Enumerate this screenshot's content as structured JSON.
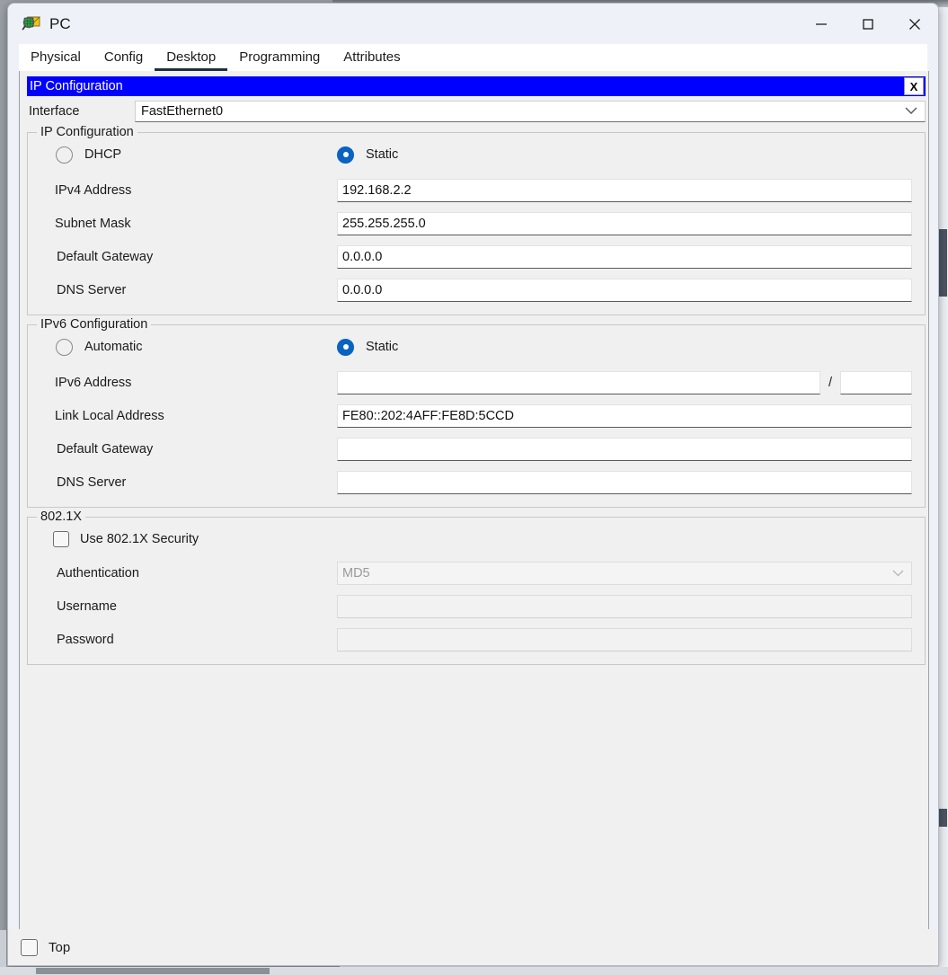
{
  "window": {
    "title": "PC",
    "icon": "packet-tracer-pc-icon",
    "controls": {
      "minimize": "—",
      "maximize": "□",
      "close": "✕"
    }
  },
  "tabs": [
    {
      "label": "Physical",
      "active": false
    },
    {
      "label": "Config",
      "active": false
    },
    {
      "label": "Desktop",
      "active": true
    },
    {
      "label": "Programming",
      "active": false
    },
    {
      "label": "Attributes",
      "active": false
    }
  ],
  "ip_configuration_panel": {
    "title": "IP Configuration",
    "close_label": "X",
    "interface": {
      "label": "Interface",
      "value": "FastEthernet0",
      "chevron": "⌄"
    },
    "ipv4": {
      "group_title": "IP Configuration",
      "mode_options": [
        {
          "label": "DHCP",
          "selected": false
        },
        {
          "label": "Static",
          "selected": true
        }
      ],
      "fields": [
        {
          "label": "IPv4 Address",
          "value": "192.168.2.2",
          "placeholder": ""
        },
        {
          "label": "Subnet Mask",
          "value": "255.255.255.0",
          "placeholder": ""
        },
        {
          "label": "Default Gateway",
          "value": "0.0.0.0",
          "placeholder": ""
        },
        {
          "label": "DNS Server",
          "value": "0.0.0.0",
          "placeholder": ""
        }
      ]
    },
    "ipv6": {
      "group_title": "IPv6 Configuration",
      "mode_options": [
        {
          "label": "Automatic",
          "selected": false
        },
        {
          "label": "Static",
          "selected": true
        }
      ],
      "address": {
        "label": "IPv6 Address",
        "value": "",
        "separator": "/",
        "prefix_value": ""
      },
      "fields": [
        {
          "label": "Link Local Address",
          "value": "FE80::202:4AFF:FE8D:5CCD"
        },
        {
          "label": "Default Gateway",
          "value": ""
        },
        {
          "label": "DNS Server",
          "value": ""
        }
      ]
    },
    "dot1x": {
      "group_title": "802.1X",
      "use_security": {
        "label": "Use 802.1X Security",
        "checked": false
      },
      "authentication": {
        "label": "Authentication",
        "value": "MD5",
        "chevron": "⌄",
        "disabled": true
      },
      "username": {
        "label": "Username",
        "value": "",
        "disabled": true
      },
      "password": {
        "label": "Password",
        "value": "",
        "disabled": true
      }
    }
  },
  "bottom": {
    "top_checkbox_label": "Top",
    "top_checkbox_checked": false
  },
  "colors": {
    "panel_title_bg": "#0000ff",
    "panel_title_fg": "#ffffff",
    "radio_selected": "#0a63c1",
    "window_bg": "#eef1f7",
    "content_bg": "#f0f0f0",
    "active_tab_underline": "#1c3040"
  }
}
